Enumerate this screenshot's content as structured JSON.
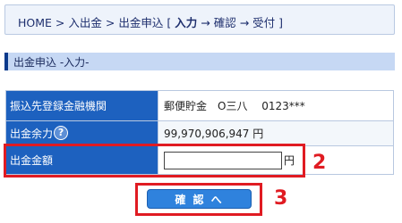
{
  "breadcrumb": {
    "home": "HOME",
    "sep1": ">",
    "item1": "入出金",
    "sep2": ">",
    "item2": "出金申込",
    "steps_open": "[",
    "step_current": "入力",
    "arrow1": "→",
    "step2": "確認",
    "arrow2": "→",
    "step3": "受付",
    "steps_close": "]"
  },
  "section": {
    "title": "出金申込 -入力-"
  },
  "form": {
    "bank_label": "振込先登録金融機関",
    "bank_value": "郵便貯金　O三八　 0123***",
    "available_label": "出金余力",
    "help_glyph": "?",
    "available_value": "99,970,906,947 円",
    "amount_label": "出金金額",
    "amount_value": "",
    "amount_unit": "円"
  },
  "buttons": {
    "confirm_label": "確 認 へ"
  },
  "annotations": {
    "step2": "2",
    "step3": "3"
  },
  "colors": {
    "header_cell": "#1d61bf",
    "section_bar": "#c6d8f4",
    "highlight": "#e01b22",
    "button": "#2f82dd"
  },
  "icons": {
    "help": "question-circle-icon"
  }
}
